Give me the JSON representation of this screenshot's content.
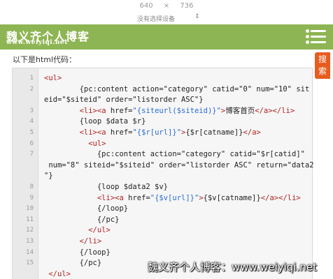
{
  "devtools": {
    "width": "640",
    "times": "×",
    "height": "736",
    "device": "没有选择设备",
    "device_arrow": "⇕"
  },
  "header": {
    "logo_cn": "魏义齐个人博客",
    "logo_url": "www.weiyiqi.net",
    "bg_color": "#8eb553"
  },
  "search_tab": {
    "label": "搜索",
    "color": "#e85c1e"
  },
  "intro": "以下是html代码：",
  "code": {
    "line_numbers": [
      "1",
      "2",
      "",
      "3",
      "4",
      "5",
      "6",
      "7",
      "",
      "",
      "8",
      "9",
      "10",
      "11",
      "12",
      "13",
      "14",
      "15"
    ],
    "lines": [
      "<ul>",
      "        {pc:content action=\"category\" catid=\"0\" num=\"10\" sit",
      "eid=\"$siteid\" order=\"listorder ASC\"}",
      "        <li><a href=\"{siteurl($siteid)}\">博客首页</a></li>",
      "        {loop $data $r}",
      "        <li><a href=\"{$r[url]}\">{$r[catname]}</a>",
      "          <ul>",
      "            {pc:content action=\"category\" catid=\"$r[catid]\"",
      " num=\"8\" siteid=\"$siteid\" order=\"listorder ASC\" return=\"data2",
      "\"}",
      "            {loop $data2 $v}",
      "            <li><a href=\"{$v[url]}\">{$v[catname]}</a></li>",
      "            {/loop}",
      "            {/pc}",
      "          </ul>",
      "        </li>",
      "        {/loop}",
      "        {/pc}",
      " </ul>"
    ]
  },
  "watermark": "魏义齐个人博客：www.weiyiqi.net"
}
